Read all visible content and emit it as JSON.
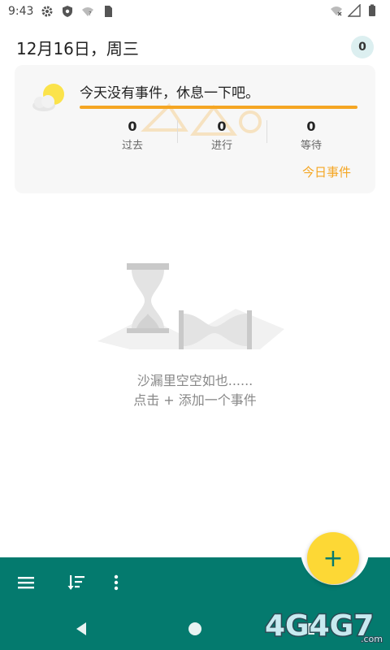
{
  "status_bar": {
    "time": "9:43",
    "icons": [
      "settings-icon",
      "shield-icon",
      "wifi-question-icon",
      "sim-card-icon"
    ],
    "right_icons": [
      "wifi-off-icon",
      "signal-icon",
      "battery-icon"
    ]
  },
  "header": {
    "date": "12月16日，周三",
    "badge_count": "0"
  },
  "summary": {
    "message": "今天没有事件，休息一下吧。",
    "progress_percent": 100,
    "accent_color": "#f5a623",
    "stats": [
      {
        "value": "0",
        "label": "过去"
      },
      {
        "value": "0",
        "label": "进行"
      },
      {
        "value": "0",
        "label": "等待"
      }
    ],
    "today_link": "今日事件"
  },
  "empty_state": {
    "line1": "沙漏里空空如也......",
    "line2": "点击 + 添加一个事件"
  },
  "bottom_bar": {
    "color": "#047a6e",
    "fab_label": "+",
    "fab_color": "#fdd835",
    "icons": [
      "menu-icon",
      "sort-icon",
      "more-vert-icon"
    ]
  },
  "nav_bar": {
    "icons": [
      "back-icon",
      "home-icon",
      "recents-icon"
    ]
  },
  "watermark": {
    "text": "4G4G7",
    "suffix": ".com"
  }
}
